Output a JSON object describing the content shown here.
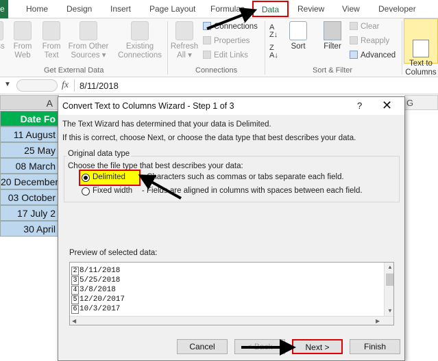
{
  "ribbon_tabs": [
    "e",
    "Home",
    "Design",
    "Insert",
    "Page Layout",
    "Formulas",
    "Data",
    "Review",
    "View",
    "Developer"
  ],
  "ribbon": {
    "get_external": {
      "from_web": "From\nWeb",
      "from_text": "From\nText",
      "from_other": "From Other\nSources ▾",
      "existing": "Existing\nConnections",
      "label": "Get External Data",
      "partial_left": "ss"
    },
    "connections": {
      "refresh": "Refresh\nAll ▾",
      "connections": "Connections",
      "properties": "Properties",
      "edit_links": "Edit Links",
      "label": "Connections"
    },
    "sort_filter": {
      "sort": "Sort",
      "filter": "Filter",
      "clear": "Clear",
      "reapply": "Reapply",
      "advanced": "Advanced",
      "label": "Sort & Filter"
    },
    "text_to_columns": "Text to\nColumns"
  },
  "formula_bar": {
    "fx": "fx",
    "value": "8/11/2018"
  },
  "sheet": {
    "col_a": "A",
    "col_g": "G",
    "header_cell": "Date Fo",
    "cells": [
      "11 August",
      "25 May",
      "08 March",
      "20 December",
      "03 October",
      "17 July 2",
      "30 April"
    ]
  },
  "dialog": {
    "title": "Convert Text to Columns Wizard - Step 1 of 3",
    "help": "?",
    "close": "✕",
    "line1": "The Text Wizard has determined that your data is Delimited.",
    "line2": "If this is correct, choose Next, or choose the data type that best describes your data.",
    "group_legend": "Original data type",
    "choose": "Choose the file type that best describes your data:",
    "opt_delimited": "Delimited",
    "opt_delimited_desc": "- Characters such as commas or tabs separate each field.",
    "opt_fixed": "Fixed width",
    "opt_fixed_desc": "- Fields are aligned in columns with spaces between each field.",
    "preview_label": "Preview of selected data:",
    "preview_rows": [
      {
        "num": "2",
        "text": "8/11/2018"
      },
      {
        "num": "3",
        "text": "5/25/2018"
      },
      {
        "num": "4",
        "text": "3/8/2018"
      },
      {
        "num": "5",
        "text": "12/20/2017"
      },
      {
        "num": "6",
        "text": "10/3/2017"
      }
    ],
    "btn_cancel": "Cancel",
    "btn_back": "< Back",
    "btn_next": "Next >",
    "btn_finish": "Finish"
  },
  "colors": {
    "excel_green": "#217346",
    "highlight_red": "#e00000",
    "highlight_yellow": "#ffff00",
    "header_green": "#00b050",
    "cell_blue": "#bdd7ee"
  }
}
